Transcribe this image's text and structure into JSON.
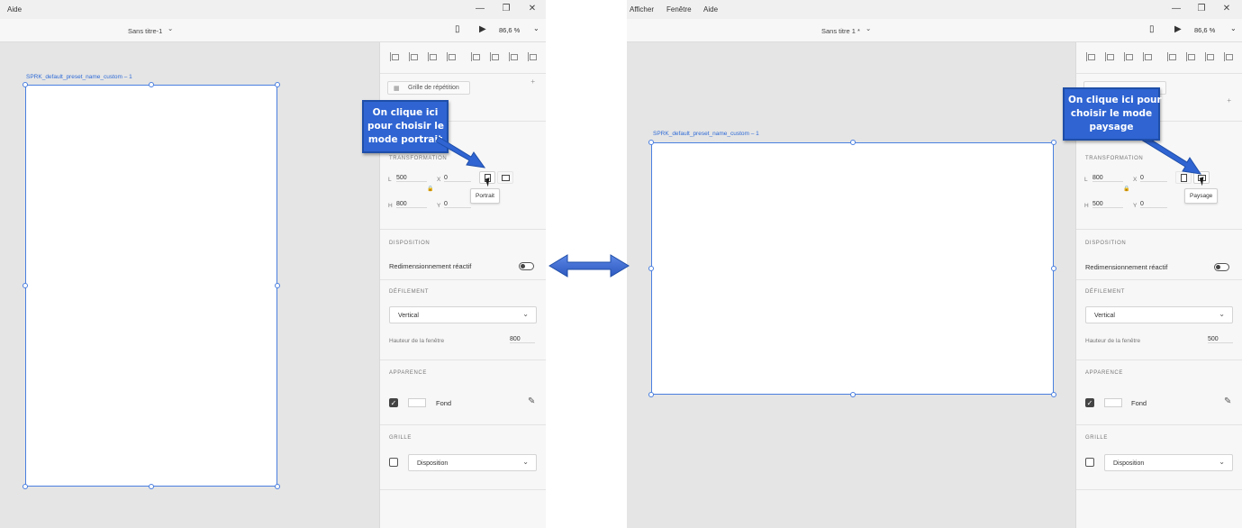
{
  "left": {
    "titlebar": {
      "menu": [
        "Aide"
      ],
      "minimize": "—",
      "maximize": "❐",
      "close": "✕"
    },
    "toolbar": {
      "doc_title": "Sans titre-1",
      "doc_chevron": "⌄",
      "zoom": "86,6 %"
    },
    "artboard_label": "SPRK_default_preset_name_custom – 1",
    "panel": {
      "grid_button": "Grille de répétition",
      "transformation": {
        "title": "TRANSFORMATION",
        "w_label": "L",
        "w_value": "500",
        "x_label": "X",
        "x_value": "0",
        "h_label": "H",
        "h_value": "800",
        "y_label": "Y",
        "y_value": "0"
      },
      "tooltip": "Portrait",
      "disposition": {
        "title": "DISPOSITION",
        "responsive_label": "Redimensionnement réactif"
      },
      "scroll": {
        "title": "DÉFILEMENT",
        "select_value": "Vertical",
        "viewport_label": "Hauteur de la fenêtre",
        "viewport_value": "800"
      },
      "appearance": {
        "title": "APPARENCE",
        "fill_label": "Fond"
      },
      "grid": {
        "title": "GRILLE",
        "select_value": "Disposition"
      }
    },
    "callout": [
      "On clique ici",
      "pour choisir le",
      "mode portrait"
    ]
  },
  "right": {
    "titlebar": {
      "menu": [
        "Afficher",
        "Fenêtre",
        "Aide"
      ],
      "minimize": "—",
      "maximize": "❐",
      "close": "✕"
    },
    "toolbar": {
      "doc_title": "Sans titre 1 *",
      "doc_chevron": "⌄",
      "zoom": "86,6 %"
    },
    "artboard_label": "SPRK_default_preset_name_custom – 1",
    "panel": {
      "transformation": {
        "title": "TRANSFORMATION",
        "w_label": "L",
        "w_value": "800",
        "x_label": "X",
        "x_value": "0",
        "h_label": "H",
        "h_value": "500",
        "y_label": "Y",
        "y_value": "0"
      },
      "tooltip": "Paysage",
      "disposition": {
        "title": "DISPOSITION",
        "responsive_label": "Redimensionnement réactif"
      },
      "scroll": {
        "title": "DÉFILEMENT",
        "select_value": "Vertical",
        "viewport_label": "Hauteur de la fenêtre",
        "viewport_value": "500"
      },
      "appearance": {
        "title": "APPARENCE",
        "fill_label": "Fond"
      },
      "grid": {
        "title": "GRILLE",
        "select_value": "Disposition"
      }
    },
    "callout": [
      "On clique ici pour",
      "choisir le mode",
      "paysage"
    ]
  },
  "colors": {
    "callout": "#2f64d2",
    "selection": "#4a7fe0",
    "arrow": "#3a6ad6"
  }
}
